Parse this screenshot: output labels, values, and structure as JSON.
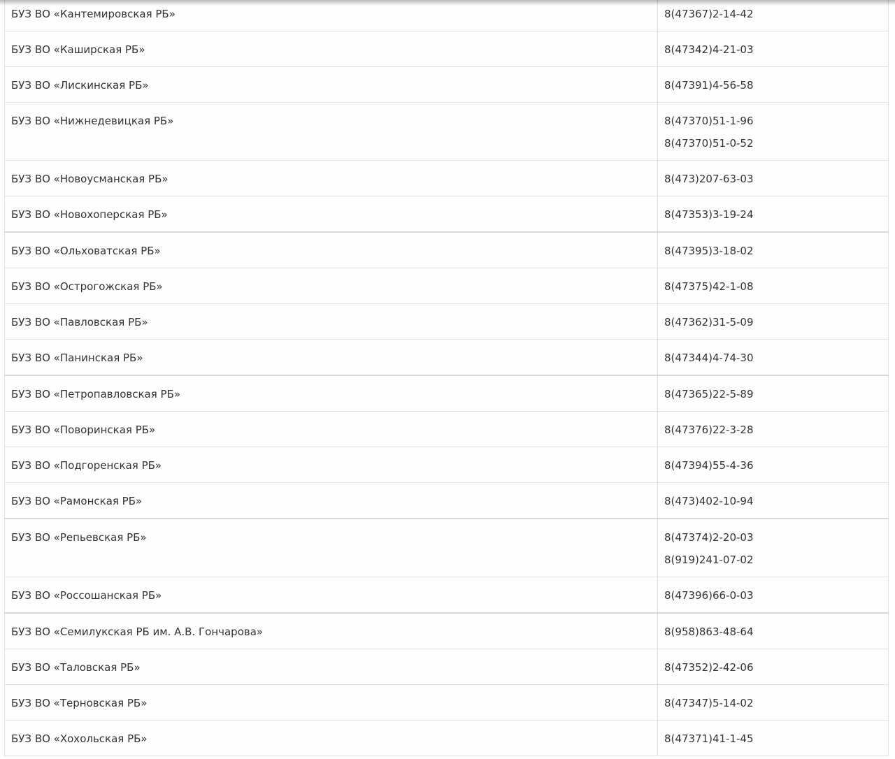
{
  "rows": [
    {
      "name": "БУЗ ВО «Кантемировская РБ»",
      "phones": [
        "8(47367)2-14-42"
      ]
    },
    {
      "name": "БУЗ ВО «Каширская РБ»",
      "phones": [
        "8(47342)4-21-03"
      ]
    },
    {
      "name": "БУЗ ВО «Лискинская РБ»",
      "phones": [
        "8(47391)4-56-58"
      ]
    },
    {
      "name": "БУЗ ВО «Нижнедевицкая РБ»",
      "phones": [
        "8(47370)51-1-96",
        "8(47370)51-0-52"
      ]
    },
    {
      "name": "БУЗ ВО «Новоусманская РБ»",
      "phones": [
        "8(473)207-63-03"
      ]
    },
    {
      "name": "БУЗ ВО «Новохоперская РБ»",
      "phones": [
        "8(47353)3-19-24"
      ]
    },
    {
      "name": "БУЗ ВО «Ольховатская РБ»",
      "phones": [
        "8(47395)3-18-02"
      ]
    },
    {
      "name": "БУЗ ВО «Острогожская РБ»",
      "phones": [
        "8(47375)42-1-08"
      ]
    },
    {
      "name": "БУЗ ВО «Павловская РБ»",
      "phones": [
        "8(47362)31-5-09"
      ]
    },
    {
      "name": "БУЗ ВО «Панинская РБ»",
      "phones": [
        "8(47344)4-74-30"
      ]
    },
    {
      "name": "БУЗ ВО «Петропавловская РБ»",
      "phones": [
        "8(47365)22-5-89"
      ]
    },
    {
      "name": "БУЗ ВО «Поворинская РБ»",
      "phones": [
        "8(47376)22-3-28"
      ]
    },
    {
      "name": "БУЗ ВО «Подгоренская РБ»",
      "phones": [
        "8(47394)55-4-36"
      ]
    },
    {
      "name": "БУЗ ВО «Рамонская РБ»",
      "phones": [
        "8(473)402-10-94"
      ]
    },
    {
      "name": "БУЗ ВО «Репьевская РБ»",
      "phones": [
        "8(47374)2-20-03",
        "8(919)241-07-02"
      ]
    },
    {
      "name": "БУЗ ВО «Россошанская РБ»",
      "phones": [
        "8(47396)66-0-03"
      ]
    },
    {
      "name": "БУЗ ВО «Семилукская РБ им. А.В. Гончарова»",
      "phones": [
        "8(958)863-48-64"
      ]
    },
    {
      "name": "БУЗ ВО «Таловская РБ»",
      "phones": [
        "8(47352)2-42-06"
      ]
    },
    {
      "name": "БУЗ ВО «Терновская РБ»",
      "phones": [
        "8(47347)5-14-02"
      ]
    },
    {
      "name": "БУЗ ВО «Хохольская РБ»",
      "phones": [
        "8(47371)41-1-45"
      ]
    }
  ]
}
